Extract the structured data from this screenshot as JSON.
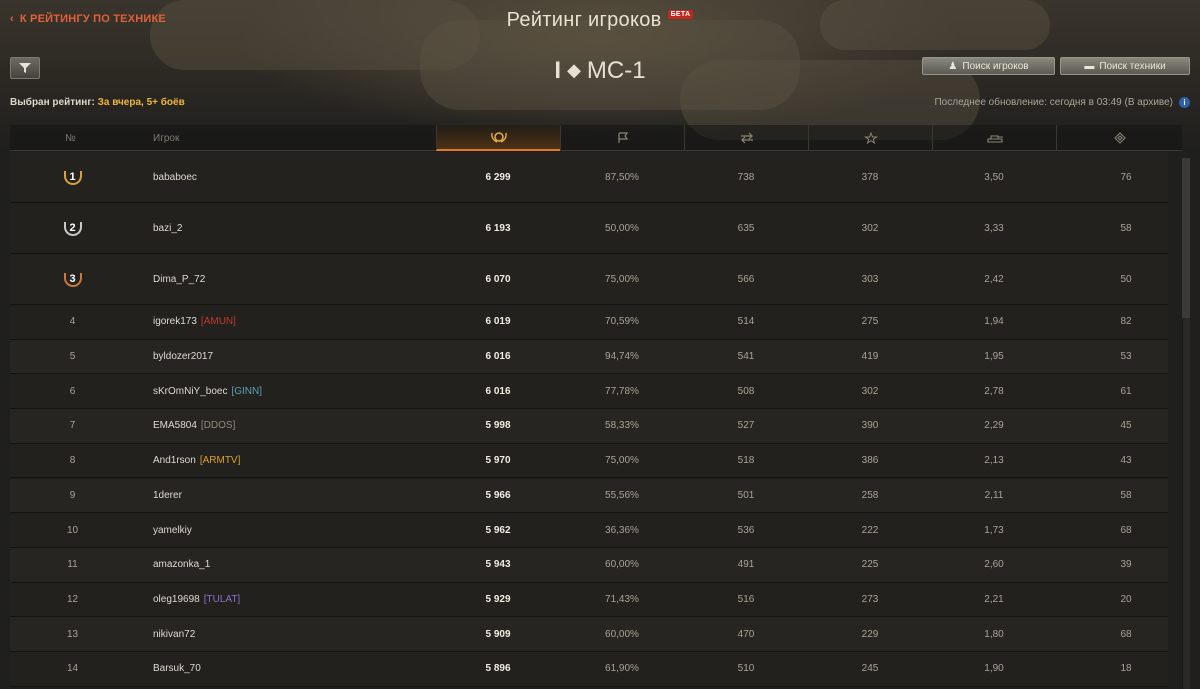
{
  "header": {
    "back_link": "К РЕЙТИНГУ ПО ТЕХНИКЕ",
    "title": "Рейтинг игроков",
    "beta_badge": "БЕТА",
    "vehicle_tier": "I",
    "vehicle_name": "МС-1",
    "search_players": "Поиск игроков",
    "search_vehicles": "Поиск техники",
    "rating_label": "Выбран рейтинг:",
    "rating_value": "За вчера, 5+ боёв",
    "update_info": "Последнее обновление: сегодня в 03:49 (В архиве)"
  },
  "table": {
    "col_rank": "№",
    "col_player": "Игрок",
    "col_icons": [
      "rating-laurel-icon",
      "flag-icon",
      "damage-arrows-icon",
      "star-icon",
      "tank-icon",
      "target-icon"
    ],
    "rows": [
      {
        "rank": "1",
        "name": "bababoec",
        "clan": "",
        "rating": "6 299",
        "winrate": "87,50%",
        "damage": "738",
        "xp": "378",
        "frags": "3,50",
        "spots": "76"
      },
      {
        "rank": "2",
        "name": "bazi_2",
        "clan": "",
        "rating": "6 193",
        "winrate": "50,00%",
        "damage": "635",
        "xp": "302",
        "frags": "3,33",
        "spots": "58"
      },
      {
        "rank": "3",
        "name": "Dima_P_72",
        "clan": "",
        "rating": "6 070",
        "winrate": "75,00%",
        "damage": "566",
        "xp": "303",
        "frags": "2,42",
        "spots": "50"
      },
      {
        "rank": "4",
        "name": "igorek173",
        "clan": "[AMUN]",
        "clan_color": "#c0392b",
        "rating": "6 019",
        "winrate": "70,59%",
        "damage": "514",
        "xp": "275",
        "frags": "1,94",
        "spots": "82"
      },
      {
        "rank": "5",
        "name": "byldozer2017",
        "clan": "",
        "rating": "6 016",
        "winrate": "94,74%",
        "damage": "541",
        "xp": "419",
        "frags": "1,95",
        "spots": "53"
      },
      {
        "rank": "6",
        "name": "sKrOmNiY_boec",
        "clan": "[GINN]",
        "clan_color": "#5fa0b8",
        "rating": "6 016",
        "winrate": "77,78%",
        "damage": "508",
        "xp": "302",
        "frags": "2,78",
        "spots": "61"
      },
      {
        "rank": "7",
        "name": "EMA5804",
        "clan": "[DDOS]",
        "clan_color": "#8f8a7e",
        "rating": "5 998",
        "winrate": "58,33%",
        "damage": "527",
        "xp": "390",
        "frags": "2,29",
        "spots": "45"
      },
      {
        "rank": "8",
        "name": "And1rson",
        "clan": "[ARMTV]",
        "clan_color": "#d9a330",
        "rating": "5 970",
        "winrate": "75,00%",
        "damage": "518",
        "xp": "386",
        "frags": "2,13",
        "spots": "43"
      },
      {
        "rank": "9",
        "name": "1derer",
        "clan": "",
        "rating": "5 966",
        "winrate": "55,56%",
        "damage": "501",
        "xp": "258",
        "frags": "2,11",
        "spots": "58"
      },
      {
        "rank": "10",
        "name": "yamelkiy",
        "clan": "",
        "rating": "5 962",
        "winrate": "36,36%",
        "damage": "536",
        "xp": "222",
        "frags": "1,73",
        "spots": "68"
      },
      {
        "rank": "11",
        "name": "amazonka_1",
        "clan": "",
        "rating": "5 943",
        "winrate": "60,00%",
        "damage": "491",
        "xp": "225",
        "frags": "2,60",
        "spots": "39"
      },
      {
        "rank": "12",
        "name": "oleg19698",
        "clan": "[TULAT]",
        "clan_color": "#8a6fc7",
        "rating": "5 929",
        "winrate": "71,43%",
        "damage": "516",
        "xp": "273",
        "frags": "2,21",
        "spots": "20"
      },
      {
        "rank": "13",
        "name": "nikivan72",
        "clan": "",
        "rating": "5 909",
        "winrate": "60,00%",
        "damage": "470",
        "xp": "229",
        "frags": "1,80",
        "spots": "68"
      },
      {
        "rank": "14",
        "name": "Barsuk_70",
        "clan": "",
        "rating": "5 896",
        "winrate": "61,90%",
        "damage": "510",
        "xp": "245",
        "frags": "1,90",
        "spots": "18"
      }
    ]
  },
  "colors": {
    "accent_orange": "#e07a1a",
    "rating_highlight": "#f0b63a",
    "gold": "#d8a23b",
    "silver": "#c9c9c9",
    "bronze": "#c9793a"
  }
}
